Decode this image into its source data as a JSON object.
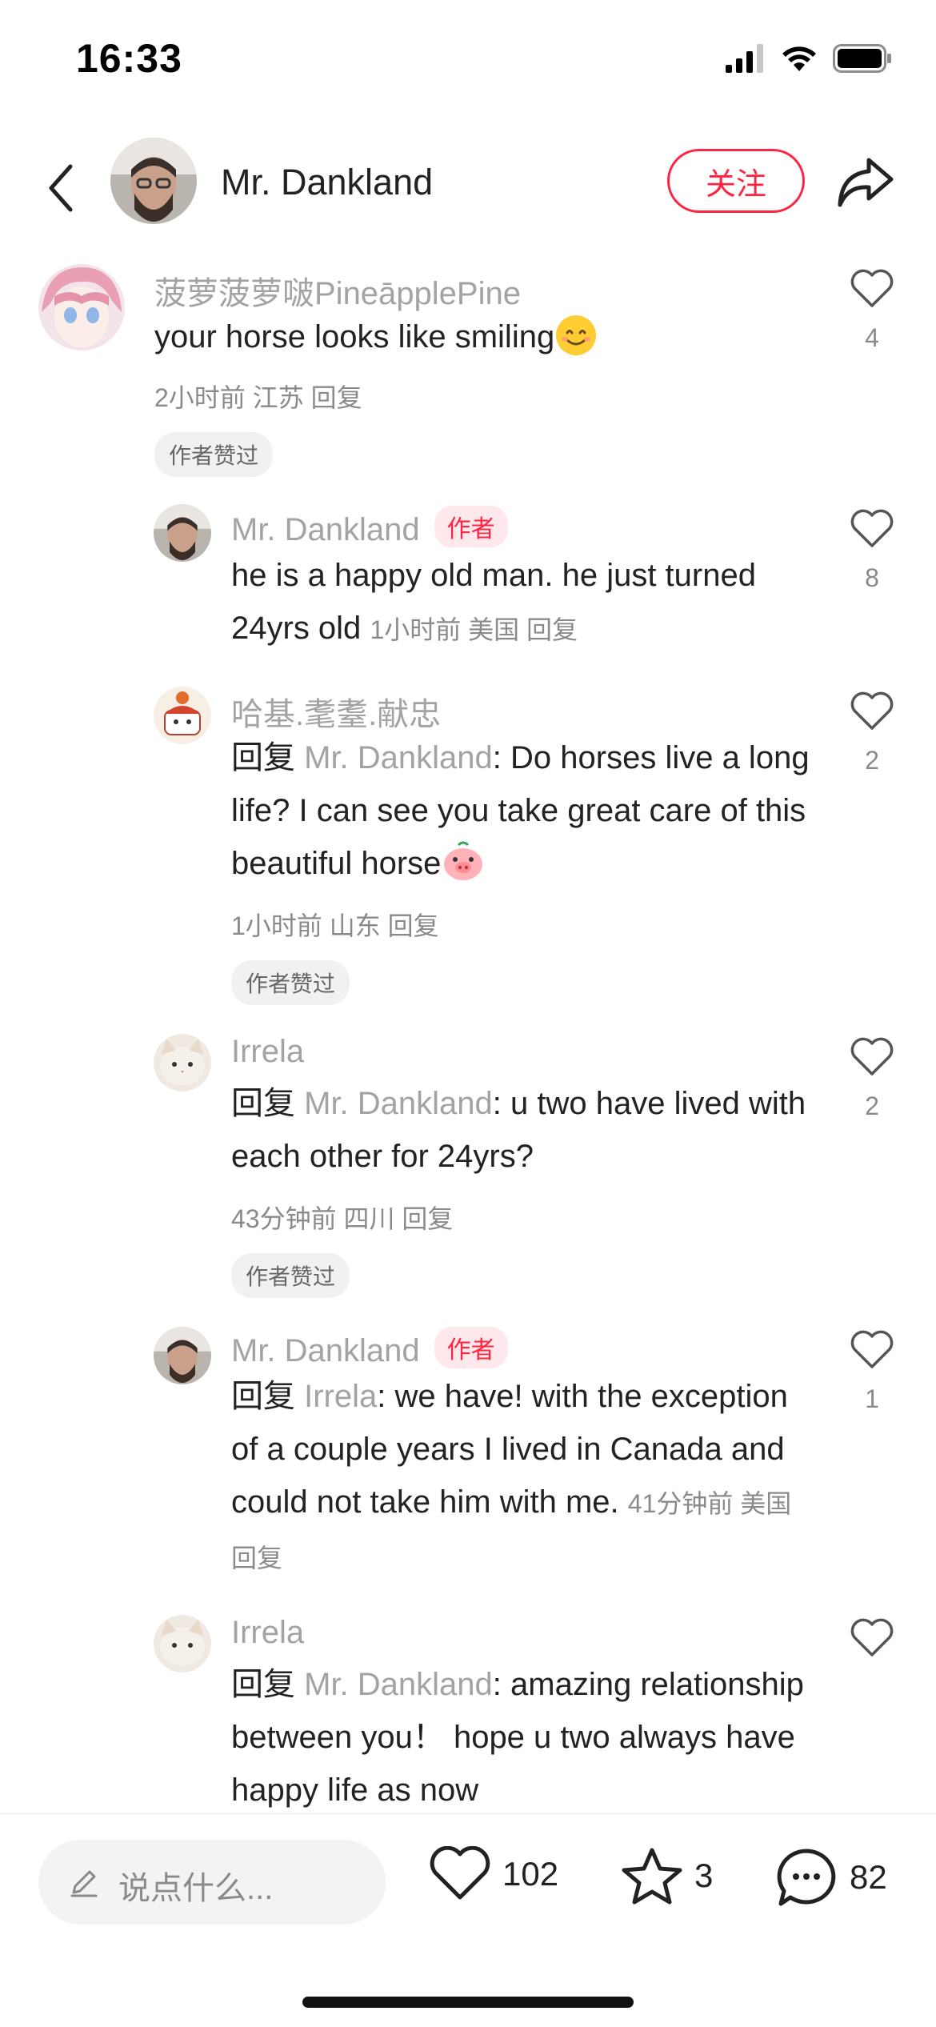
{
  "status_bar": {
    "time": "16:33",
    "signal_bars": 3,
    "wifi": true,
    "battery_level": 0.9
  },
  "header": {
    "author_name": "Mr. Dankland",
    "follow_label": "关注"
  },
  "comments": [
    {
      "name": "菠萝菠萝啵PineāpplePine",
      "text": "your horse looks like smiling",
      "meta": "2小时前 江苏 回复",
      "liked_badge": "作者赞过",
      "likes": "4"
    },
    {
      "name": "Mr. Dankland",
      "tag": "作者",
      "text": "he is a happy old man. he just turned 24yrs old",
      "meta": "1小时前 美国 回复",
      "likes": "8"
    },
    {
      "name": "哈基.耄耋.献忠",
      "reply_prefix": "回复",
      "reply_to": "Mr. Dankland",
      "text": ": Do horses live a long life? I can see you take great care of this beautiful horse",
      "meta": "1小时前 山东 回复",
      "liked_badge": "作者赞过",
      "likes": "2"
    },
    {
      "name": "Irrela",
      "reply_prefix": "回复",
      "reply_to": "Mr. Dankland",
      "text": ": u two have lived with each other for 24yrs?",
      "meta": "43分钟前 四川 回复",
      "liked_badge": "作者赞过",
      "likes": "2"
    },
    {
      "name": "Mr. Dankland",
      "tag": "作者",
      "reply_prefix": "回复",
      "reply_to": "Irrela",
      "text": ": we have! with the exception of a couple years I lived in Canada and could not take him with me.",
      "meta": "41分钟前 美国 回复",
      "likes": "1"
    },
    {
      "name": "Irrela",
      "reply_prefix": "回复",
      "reply_to": "Mr. Dankland",
      "text": ": amazing relationship between you！  hope u two always have happy life as now",
      "likes": ""
    }
  ],
  "bottom_bar": {
    "input_placeholder": "说点什么...",
    "likes": "102",
    "stars": "3",
    "comments": "82"
  },
  "colors": {
    "accent": "#ff2442",
    "muted": "#a3a3a3",
    "text": "#222222"
  }
}
